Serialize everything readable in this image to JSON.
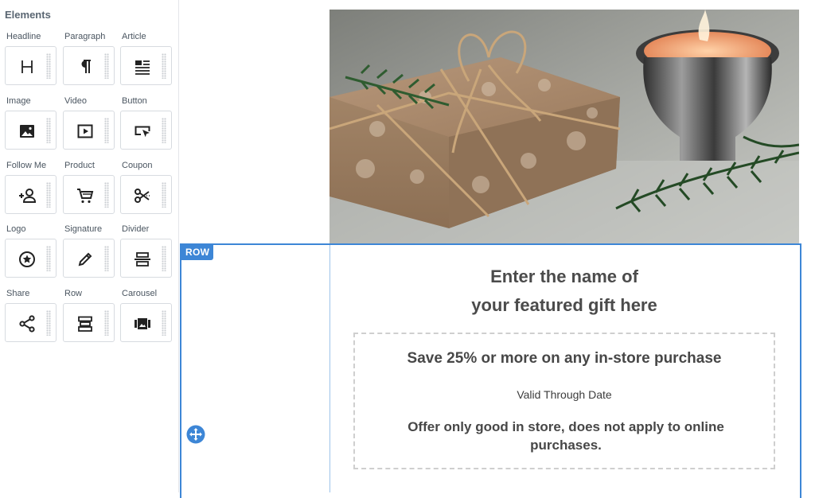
{
  "sidebar": {
    "title": "Elements",
    "items": [
      {
        "label": "Headline",
        "icon": "headline-icon"
      },
      {
        "label": "Paragraph",
        "icon": "paragraph-icon"
      },
      {
        "label": "Article",
        "icon": "article-icon"
      },
      {
        "label": "Image",
        "icon": "image-icon"
      },
      {
        "label": "Video",
        "icon": "video-icon"
      },
      {
        "label": "Button",
        "icon": "button-icon"
      },
      {
        "label": "Follow Me",
        "icon": "follow-me-icon"
      },
      {
        "label": "Product",
        "icon": "cart-icon"
      },
      {
        "label": "Coupon",
        "icon": "scissors-icon"
      },
      {
        "label": "Logo",
        "icon": "logo-star-icon"
      },
      {
        "label": "Signature",
        "icon": "pen-icon"
      },
      {
        "label": "Divider",
        "icon": "divider-icon"
      },
      {
        "label": "Share",
        "icon": "share-icon"
      },
      {
        "label": "Row",
        "icon": "row-icon"
      },
      {
        "label": "Carousel",
        "icon": "carousel-icon"
      }
    ]
  },
  "canvas": {
    "row_tag": "ROW",
    "heading_line1": "Enter the name of",
    "heading_line2": "your featured gift here",
    "coupon": {
      "title": "Save 25% or more on any in-store purchase",
      "valid": "Valid Through Date",
      "terms": "Offer only good in store, does not apply to online purchases."
    }
  },
  "colors": {
    "accent": "#3d86d6",
    "text_dark": "#474747"
  }
}
